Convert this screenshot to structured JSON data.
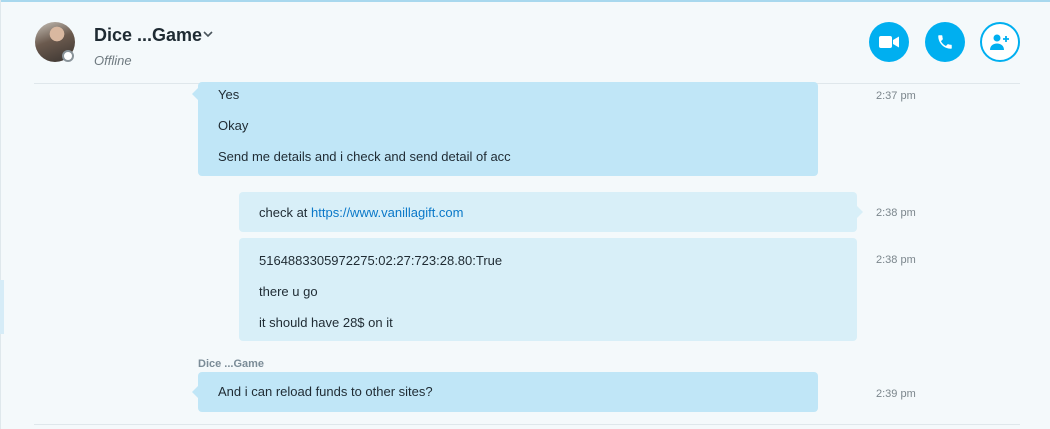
{
  "header": {
    "contact_name": "Dice ...Game",
    "status": "Offline",
    "buttons": {
      "video": "video-call",
      "call": "audio-call",
      "add": "add-people"
    }
  },
  "messages": [
    {
      "direction": "incoming",
      "lines": [
        "Yes",
        "Okay",
        "Send me details and i check and send detail of acc"
      ],
      "time": "2:37 pm"
    },
    {
      "direction": "outgoing",
      "prefix": "check at ",
      "link": "https://www.vanillagift.com",
      "time": "2:38 pm"
    },
    {
      "direction": "outgoing",
      "lines": [
        "5164883305972275:02:27:723:28.80:True",
        "there u go",
        "it should have 28$ on it"
      ],
      "time": "2:38 pm"
    },
    {
      "direction": "incoming",
      "sender": "Dice ...Game",
      "lines": [
        "And i can reload funds to other sites?"
      ],
      "time": "2:39 pm"
    }
  ],
  "colors": {
    "accent": "#00aff0",
    "incoming_bubble": "#c0e6f7",
    "outgoing_bubble": "#d8eff8",
    "link": "#0a78c8",
    "background": "#f4f9fb"
  },
  "icons": [
    "video-camera-icon",
    "phone-icon",
    "add-person-icon",
    "chevron-down-icon"
  ]
}
